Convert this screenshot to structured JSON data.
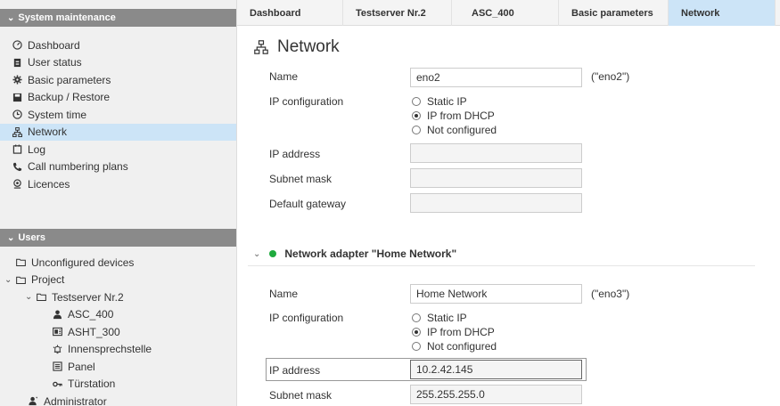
{
  "sidebar": {
    "system_section": {
      "label": "System maintenance"
    },
    "menu": [
      {
        "label": "Dashboard",
        "icon": "dashboard-icon"
      },
      {
        "label": "User status",
        "icon": "user-status-icon"
      },
      {
        "label": "Basic parameters",
        "icon": "gear-icon"
      },
      {
        "label": "Backup / Restore",
        "icon": "backup-icon"
      },
      {
        "label": "System time",
        "icon": "clock-icon"
      },
      {
        "label": "Network",
        "icon": "network-icon",
        "active": true
      },
      {
        "label": "Log",
        "icon": "log-icon"
      },
      {
        "label": "Call numbering plans",
        "icon": "phone-icon"
      },
      {
        "label": "Licences",
        "icon": "licence-icon"
      }
    ],
    "users_section": {
      "label": "Users"
    },
    "tree": [
      {
        "label": "Unconfigured devices",
        "icon": "folder-icon"
      },
      {
        "label": "Project",
        "icon": "folder-icon"
      },
      {
        "label": "Testserver Nr.2",
        "icon": "folder-icon"
      },
      {
        "label": "ASC_400",
        "icon": "user-station-icon"
      },
      {
        "label": "ASHT_300",
        "icon": "display-device-icon"
      },
      {
        "label": "Innensprechstelle",
        "icon": "bell-icon"
      },
      {
        "label": "Panel",
        "icon": "panel-icon"
      },
      {
        "label": "Türstation",
        "icon": "key-icon"
      },
      {
        "label": "Administrator",
        "icon": "admin-icon"
      }
    ]
  },
  "tabs": [
    {
      "label": "Dashboard"
    },
    {
      "label": "Testserver Nr.2"
    },
    {
      "label": "ASC_400"
    },
    {
      "label": "Basic parameters"
    },
    {
      "label": "Network",
      "active": true
    }
  ],
  "page": {
    "title": "Network",
    "title_icon": "network-icon"
  },
  "adapter1": {
    "name_label": "Name",
    "name_value": "eno2",
    "name_hint": "(\"eno2\")",
    "ipconf_label": "IP configuration",
    "options": [
      "Static IP",
      "IP from DHCP",
      "Not configured"
    ],
    "selected": "IP from DHCP",
    "ip_label": "IP address",
    "ip_value": "",
    "mask_label": "Subnet mask",
    "mask_value": "",
    "gw_label": "Default gateway",
    "gw_value": ""
  },
  "adapter2": {
    "header": "Network adapter \"Home Network\"",
    "status_color": "#1faa3e",
    "name_label": "Name",
    "name_value": "Home Network",
    "name_hint": "(\"eno3\")",
    "ipconf_label": "IP configuration",
    "options": [
      "Static IP",
      "IP from DHCP",
      "Not configured"
    ],
    "selected": "IP from DHCP",
    "ip_label": "IP address",
    "ip_value": "10.2.42.145",
    "mask_label": "Subnet mask",
    "mask_value": "255.255.255.0"
  },
  "colors": {
    "accent": "#cce4f7",
    "section_header": "#8a8a8a"
  }
}
